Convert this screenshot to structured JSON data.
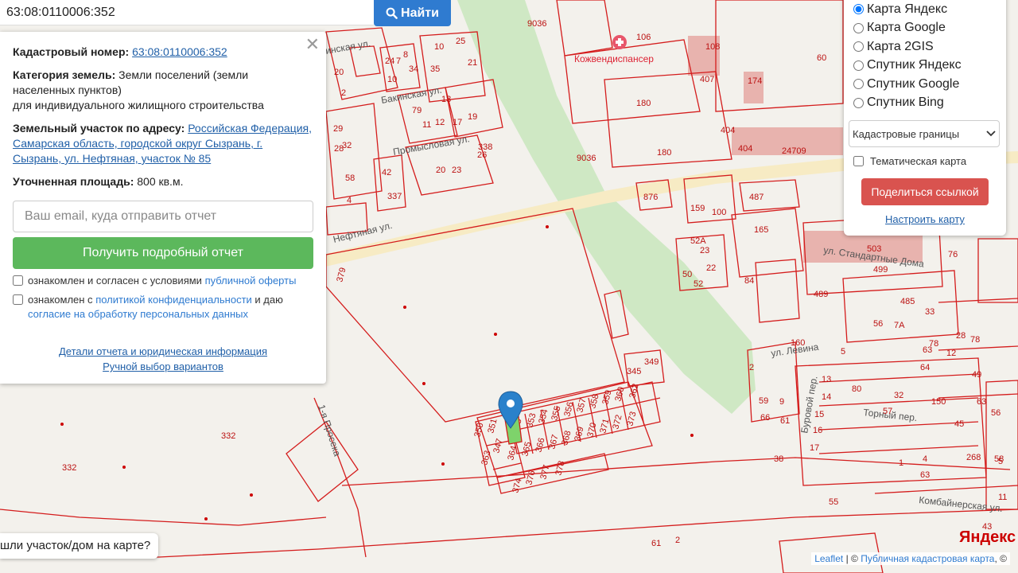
{
  "search": {
    "value": "63:08:0110006:352",
    "button_label": "Найти"
  },
  "info": {
    "cadastral_label": "Кадастровый номер:",
    "cadastral_value": "63:08:0110006:352",
    "category_label": "Категория земель:",
    "category_value": "Земли поселений (земли населенных пунктов)",
    "category_use": "для индивидуального жилищного строительства",
    "address_label": "Земельный участок по адресу:",
    "address_value": "Российская Федерация, Самарская область, городской округ Сызрань, г. Сызрань, ул. Нефтяная, участок № 85",
    "area_label": "Уточненная площадь:",
    "area_value": "800 кв.м.",
    "email_placeholder": "Ваш email, куда отправить отчет",
    "report_button": "Получить подробный отчет",
    "consent1_text": "ознакомлен и согласен с условиями ",
    "consent1_link": "публичной оферты",
    "consent2_text": "ознакомлен с ",
    "consent2_link": "политикой конфиденциальности",
    "consent2_mid": " и даю ",
    "consent2_link2": "согласие на обработку персональных данных",
    "details_link": "Детали отчета и юридическая информация",
    "manual_link": "Ручной выбор вариантов"
  },
  "layers": {
    "options": [
      {
        "label": "Карта Яндекс",
        "checked": true
      },
      {
        "label": "Карта Google",
        "checked": false
      },
      {
        "label": "Карта 2GIS",
        "checked": false
      },
      {
        "label": "Спутник Яндекс",
        "checked": false
      },
      {
        "label": "Спутник Google",
        "checked": false
      },
      {
        "label": "Спутник Bing",
        "checked": false
      }
    ],
    "select_value": "Кадастровые границы",
    "thematic_label": "Тематическая карта",
    "share_button": "Поделиться ссылкой",
    "config_link": "Настроить карту"
  },
  "footer": {
    "found_tip": "шли участок/дом на карте?",
    "yandex_logo": "Яндекс",
    "attribution_leaflet": "Leaflet",
    "attribution_sep": " | © ",
    "attribution_map": "Публичная кадастровая карта",
    "attribution_end": ", ©"
  },
  "map": {
    "streets": {
      "neftyanaya": "Нефтяная ул.",
      "bakinskaya": "Бакинская ул.",
      "promyslovaya": "Промысловая ул.",
      "levina": "ул. Левина",
      "prosek": "1-я Просека",
      "kombainerskaya": "Комбайнерская ул.",
      "standartnye": "ул. Стандартные Дома",
      "torny": "Торный пер.",
      "burovoy": "Буровой пер.",
      "kozhdispanser": "Кожвендиспансер",
      "inskaya": "инская ул."
    },
    "labels": [
      "9036",
      "106",
      "108",
      "407",
      "174",
      "60",
      "180",
      "404",
      "24709",
      "9036",
      "180",
      "404",
      "876",
      "159",
      "100",
      "487",
      "165",
      "52А",
      "503",
      "499",
      "485",
      "489",
      "160",
      "56",
      "7А",
      "63",
      "64",
      "2",
      "13",
      "14",
      "15",
      "16",
      "17",
      "59",
      "9",
      "66",
      "61",
      "80",
      "32",
      "150",
      "45",
      "56",
      "55",
      "61",
      "2",
      "332",
      "332",
      "345",
      "349",
      "350",
      "351",
      "347",
      "363",
      "348",
      "353",
      "354",
      "355",
      "356",
      "357",
      "358",
      "359",
      "360",
      "362",
      "364",
      "365",
      "366",
      "367",
      "368",
      "369",
      "370",
      "371",
      "372",
      "373",
      "374",
      "376",
      "377",
      "378",
      "379",
      "42",
      "52",
      "22",
      "23",
      "84",
      "50",
      "5",
      "28",
      "78",
      "49",
      "33",
      "38",
      "12",
      "4",
      "63",
      "43",
      "1",
      "57",
      "58",
      "5",
      "11",
      "10",
      "25",
      "21",
      "24",
      "7",
      "8",
      "10",
      "79",
      "11",
      "12",
      "13",
      "17",
      "19",
      "20",
      "23",
      "26",
      "338",
      "29",
      "28",
      "32",
      "58",
      "4",
      "337",
      "20",
      "2",
      "34",
      "35",
      "76",
      "78",
      "268",
      "63",
      "73",
      "64"
    ]
  }
}
